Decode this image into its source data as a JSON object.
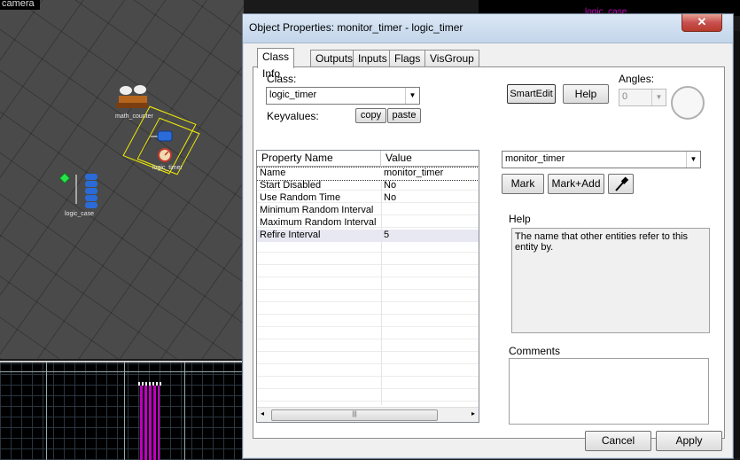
{
  "viewport3d": {
    "camera_label": "camera",
    "entities": [
      {
        "label": "math_counter"
      },
      {
        "label": "logic_timer"
      },
      {
        "label": "logic_case"
      }
    ]
  },
  "background": {
    "right_label": "logic_case"
  },
  "dialog": {
    "title": "Object Properties: monitor_timer - logic_timer",
    "close_glyph": "✕",
    "tabs": [
      {
        "label": "Class Info",
        "active": true
      },
      {
        "label": "Outputs"
      },
      {
        "label": "Inputs"
      },
      {
        "label": "Flags"
      },
      {
        "label": "VisGroup"
      }
    ],
    "class_label": "Class:",
    "class_value": "logic_timer",
    "keyvalues_label": "Keyvalues:",
    "copy_label": "copy",
    "paste_label": "paste",
    "smartedit_label": "SmartEdit",
    "help_button_label": "Help",
    "angles_label": "Angles:",
    "angles_value": "0",
    "grid": {
      "headers": [
        "Property Name",
        "Value"
      ],
      "rows": [
        {
          "key": "Name",
          "value": "monitor_timer"
        },
        {
          "key": "Start Disabled",
          "value": "No"
        },
        {
          "key": "Use Random Time",
          "value": "No"
        },
        {
          "key": "Minimum Random Interval",
          "value": ""
        },
        {
          "key": "Maximum Random Interval",
          "value": ""
        },
        {
          "key": "Refire Interval",
          "value": "5"
        }
      ],
      "scroll_left": "◂",
      "scroll_right": "▸",
      "scroll_grip": "|||"
    },
    "value_combo": "monitor_timer",
    "mark_label": "Mark",
    "mark_add_label": "Mark+Add",
    "eyedropper_icon": "eyedropper-icon",
    "help_label": "Help",
    "help_text": "The name that other entities refer to this entity by.",
    "comments_label": "Comments",
    "cancel_label": "Cancel",
    "apply_label": "Apply"
  }
}
